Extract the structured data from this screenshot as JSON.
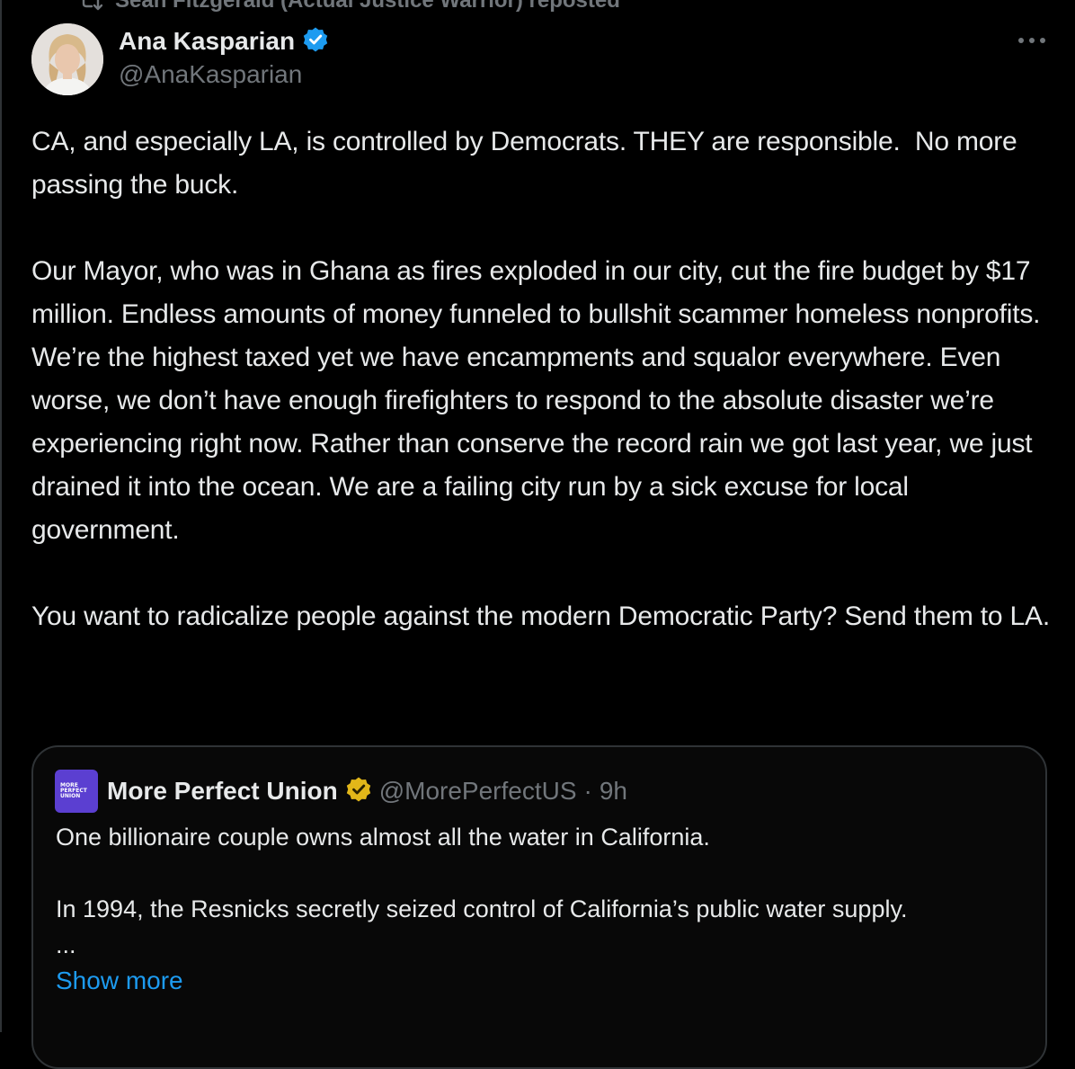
{
  "repost": {
    "text": "Sean Fitzgerald (Actual Justice Warrior) reposted",
    "icon": "repost-icon"
  },
  "author": {
    "name": "Ana Kasparian",
    "handle": "@AnaKasparian",
    "verified_icon": "verified-badge-icon",
    "verified_color": "#1d9bf0"
  },
  "post": {
    "paragraphs": [
      "CA, and especially LA, is controlled by Democrats. THEY are responsible.  No more passing the buck.",
      "Our Mayor, who was in Ghana as fires exploded in our city, cut the fire budget by $17 million. Endless amounts of money funneled to bullshit scammer homeless nonprofits. We’re the highest taxed yet we have encampments and squalor everywhere. Even worse, we don’t have enough firefighters to respond to the absolute disaster we’re experiencing right now. Rather than conserve the record rain we got last year, we just drained it into the ocean. We are a failing city run by a sick excuse for local government.",
      "You want to radicalize people against the modern Democratic Party? Send them to LA."
    ]
  },
  "quote": {
    "logo_lines": [
      "MORE",
      "PERFECT",
      "UNION"
    ],
    "name": "More Perfect Union",
    "verified_icon": "gold-verified-badge-icon",
    "verified_color": "#e2b719",
    "handle": "@MorePerfectUS",
    "separator": "·",
    "time": "9h",
    "paragraph1": "One billionaire couple owns almost all the water in California.",
    "paragraph2": "In 1994, the Resnicks secretly seized control of California’s public water supply.",
    "ellipsis": "...",
    "show_more": "Show more"
  },
  "colors": {
    "background": "#000000",
    "text": "#e7e9ea",
    "secondary": "#71767b",
    "link": "#1d9bf0",
    "border": "#2f3336"
  }
}
